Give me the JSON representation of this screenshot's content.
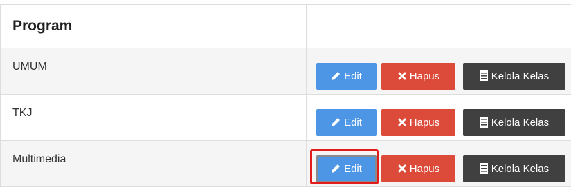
{
  "table": {
    "header": {
      "program": "Program",
      "actions": ""
    },
    "rows": [
      {
        "name": "UMUM"
      },
      {
        "name": "TKJ"
      },
      {
        "name": "Multimedia"
      }
    ],
    "buttons": {
      "edit": "Edit",
      "hapus": "Hapus",
      "kelola": "Kelola Kelas"
    }
  },
  "highlight": {
    "row_index": 2,
    "target": "edit-button"
  },
  "colors": {
    "edit": "#4d96e6",
    "hapus": "#dc4b39",
    "kelola": "#404040",
    "highlight": "#e21b1b"
  },
  "icons": {
    "edit": "pencil-icon",
    "hapus": "x-icon",
    "kelola": "list-document-icon"
  }
}
